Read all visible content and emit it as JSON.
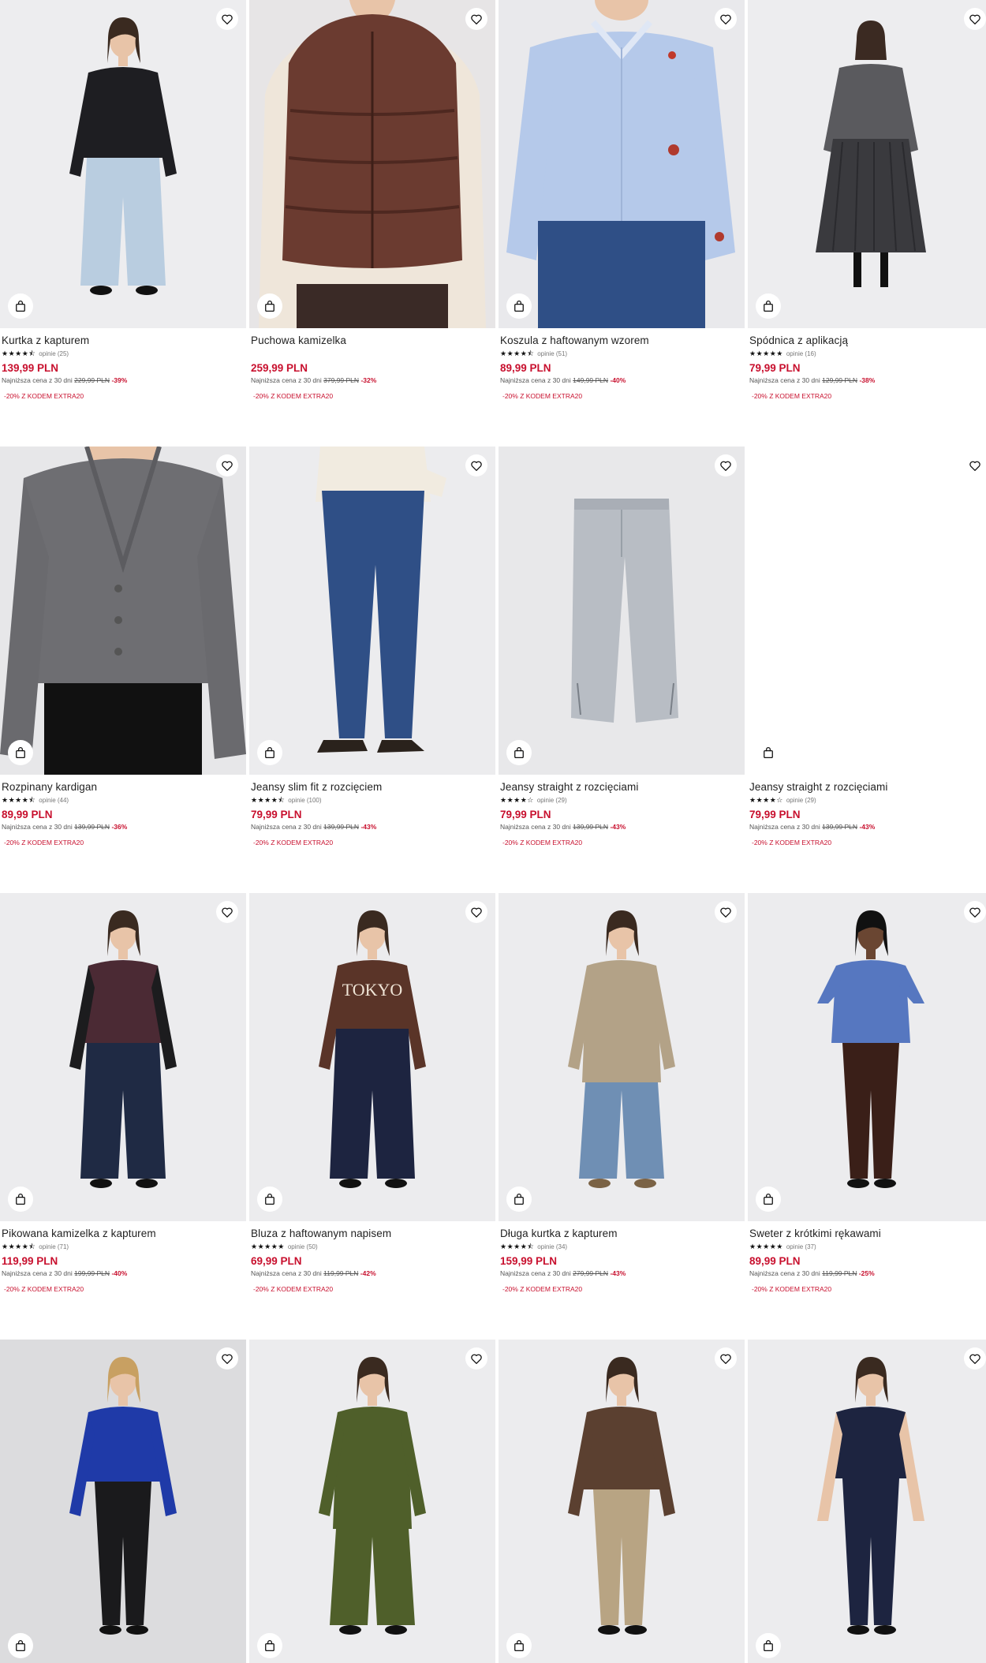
{
  "colors": {
    "price": "#c8102e",
    "promo": "#c8102e",
    "photo_bg": "#ececee"
  },
  "products": [
    {
      "name": "Kurtka z kapturem",
      "stars": "★★★★⯪",
      "reviews": "opinie (25)",
      "price": "139,99 PLN",
      "lowest_label": "Najniższa cena z 30 dni",
      "old_price": "229,99 PLN",
      "discount": "-39%",
      "promo": "-20% Z KODEM EXTRA20",
      "image": "woman-black-jacket-light-jeans"
    },
    {
      "name": "Puchowa kamizelka",
      "stars": "",
      "reviews": "",
      "price": "259,99 PLN",
      "lowest_label": "Najniższa cena z 30 dni",
      "old_price": "379,99 PLN",
      "discount": "-32%",
      "promo": "-20% Z KODEM EXTRA20",
      "image": "brown-puffer-vest"
    },
    {
      "name": "Koszula z haftowanym wzorem",
      "stars": "★★★★⯪",
      "reviews": "opinie (51)",
      "price": "89,99 PLN",
      "lowest_label": "Najniższa cena z 30 dni",
      "old_price": "149,99 PLN",
      "discount": "-40%",
      "promo": "-20% Z KODEM EXTRA20",
      "image": "light-blue-embroidered-shirt"
    },
    {
      "name": "Spódnica z aplikacją",
      "stars": "★★★★★",
      "reviews": "opinie (16)",
      "price": "79,99 PLN",
      "lowest_label": "Najniższa cena z 30 dni",
      "old_price": "129,99 PLN",
      "discount": "-38%",
      "promo": "-20% Z KODEM EXTRA20",
      "image": "woman-grey-cardigan-pleated-skirt"
    },
    {
      "name": "Rozpinany kardigan",
      "stars": "★★★★⯪",
      "reviews": "opinie (44)",
      "price": "89,99 PLN",
      "lowest_label": "Najniższa cena z 30 dni",
      "old_price": "139,99 PLN",
      "discount": "-36%",
      "promo": "-20% Z KODEM EXTRA20",
      "image": "grey-cardigan"
    },
    {
      "name": "Jeansy slim fit z rozcięciem",
      "stars": "★★★★⯪",
      "reviews": "opinie (100)",
      "price": "79,99 PLN",
      "lowest_label": "Najniższa cena z 30 dni",
      "old_price": "139,99 PLN",
      "discount": "-43%",
      "promo": "-20% Z KODEM EXTRA20",
      "image": "dark-blue-slim-jeans"
    },
    {
      "name": "Jeansy straight z rozcięciami",
      "stars": "★★★★☆",
      "reviews": "opinie (29)",
      "price": "79,99 PLN",
      "lowest_label": "Najniższa cena z 30 dni",
      "old_price": "139,99 PLN",
      "discount": "-43%",
      "promo": "-20% Z KODEM EXTRA20",
      "image": "light-grey-straight-jeans"
    },
    {
      "name": "Jeansy straight z rozcięciami",
      "stars": "★★★★☆",
      "reviews": "opinie (29)",
      "price": "79,99 PLN",
      "lowest_label": "Najniższa cena z 30 dni",
      "old_price": "139,99 PLN",
      "discount": "-43%",
      "promo": "-20% Z KODEM EXTRA20",
      "image": "blank"
    },
    {
      "name": "Pikowana kamizelka z kapturem",
      "stars": "★★★★⯪",
      "reviews": "opinie (71)",
      "price": "119,99 PLN",
      "lowest_label": "Najniższa cena z 30 dni",
      "old_price": "199,99 PLN",
      "discount": "-40%",
      "promo": "-20% Z KODEM EXTRA20",
      "image": "woman-quilted-vest-dark-jeans"
    },
    {
      "name": "Bluza z haftowanym napisem",
      "stars": "★★★★★",
      "reviews": "opinie (50)",
      "price": "69,99 PLN",
      "lowest_label": "Najniższa cena z 30 dni",
      "old_price": "119,99 PLN",
      "discount": "-42%",
      "promo": "-20% Z KODEM EXTRA20",
      "image": "brown-tokyo-sweatshirt",
      "print_text": "TOKYO"
    },
    {
      "name": "Długa kurtka z kapturem",
      "stars": "★★★★⯪",
      "reviews": "opinie (34)",
      "price": "159,99 PLN",
      "lowest_label": "Najniższa cena z 30 dni",
      "old_price": "279,99 PLN",
      "discount": "-43%",
      "promo": "-20% Z KODEM EXTRA20",
      "image": "woman-beige-long-jacket"
    },
    {
      "name": "Sweter z krótkimi rękawami",
      "stars": "★★★★★",
      "reviews": "opinie (37)",
      "price": "89,99 PLN",
      "lowest_label": "Najniższa cena z 30 dni",
      "old_price": "119,99 PLN",
      "discount": "-25%",
      "promo": "-20% Z KODEM EXTRA20",
      "image": "woman-blue-short-sleeve-sweater"
    },
    {
      "name": "",
      "stars": "",
      "reviews": "",
      "price": "",
      "lowest_label": "",
      "old_price": "",
      "discount": "",
      "promo": "",
      "image": "woman-cobalt-sweater-leather-pants"
    },
    {
      "name": "",
      "stars": "",
      "reviews": "",
      "price": "",
      "lowest_label": "",
      "old_price": "",
      "discount": "",
      "promo": "",
      "image": "woman-green-print-dress"
    },
    {
      "name": "",
      "stars": "",
      "reviews": "",
      "price": "",
      "lowest_label": "",
      "old_price": "",
      "discount": "",
      "promo": "",
      "image": "woman-brown-leather-jacket-beige-pants"
    },
    {
      "name": "",
      "stars": "",
      "reviews": "",
      "price": "",
      "lowest_label": "",
      "old_price": "",
      "discount": "",
      "promo": "",
      "image": "woman-navy-peplum-top-pants"
    }
  ]
}
